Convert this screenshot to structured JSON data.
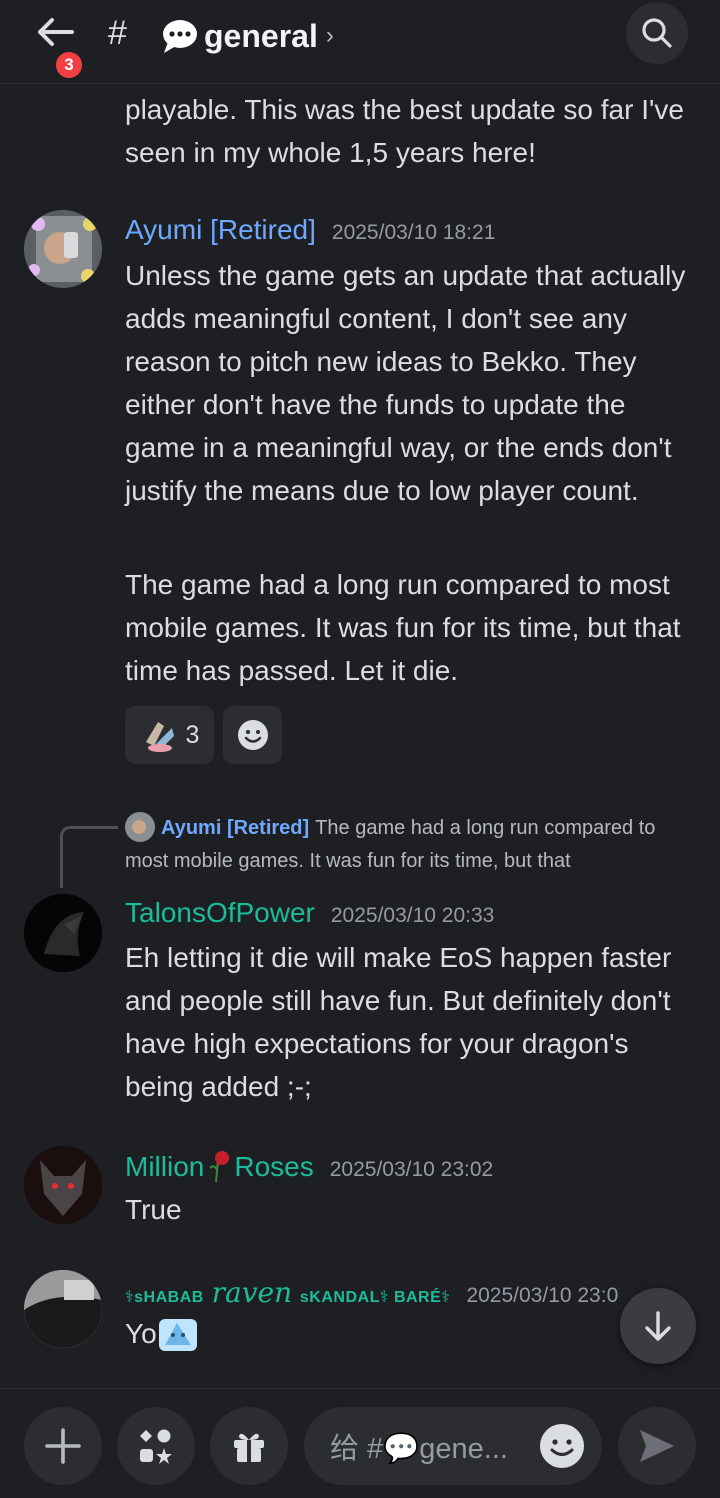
{
  "header": {
    "back_badge": "3",
    "hash": "#",
    "channel_name": "general",
    "chevron": "›"
  },
  "messages": [
    {
      "continued_text": "playable. This was the best update so far I've seen in my whole 1,5 years here!"
    },
    {
      "author": "Ayumi [Retired]",
      "author_color": "#6fa8ff",
      "timestamp": "2025/03/10 18:21",
      "paragraphs": [
        "Unless the game gets an update that actually adds meaningful content, I don't see any reason to pitch new ideas to Bekko. They either don't have the funds to update the game in a meaningful way, or the ends don't justify the means due to low player count.",
        "The game had a long run compared to most mobile games. It was fun for its time, but that time has passed. Let it die."
      ],
      "reactions": [
        {
          "emoji": "custom-emoji",
          "count": "3"
        }
      ]
    },
    {
      "reply_to": {
        "author": "Ayumi [Retired]",
        "text": "The game had a long run compared to most mobile games. It was fun for its time, but that"
      },
      "author": "TalonsOfPower",
      "author_color": "#1abc9c",
      "timestamp": "2025/03/10 20:33",
      "text": "Eh letting it die will make EoS happen faster and people still have fun. But definitely don't have high expectations for your dragon's being added ;-;"
    },
    {
      "author_part1": "Million",
      "author_part2": "Roses",
      "author_color": "#1abc9c",
      "timestamp": "2025/03/10 23:02",
      "text": "True"
    },
    {
      "author_prefix": "⚕sHABAB",
      "author_main": "raven",
      "author_suffix": "sKANDAL⚕ BARÉ⚕",
      "author_color": "#1abc9c",
      "timestamp": "2025/03/10 23:0",
      "text": "Yo"
    }
  ],
  "input": {
    "placeholder": "给 #💬gene..."
  },
  "colors": {
    "background": "#1e1f22",
    "surface": "#2b2d31",
    "blurple_name": "#6fa8ff",
    "teal_name": "#1abc9c",
    "badge_red": "#f23f43"
  }
}
